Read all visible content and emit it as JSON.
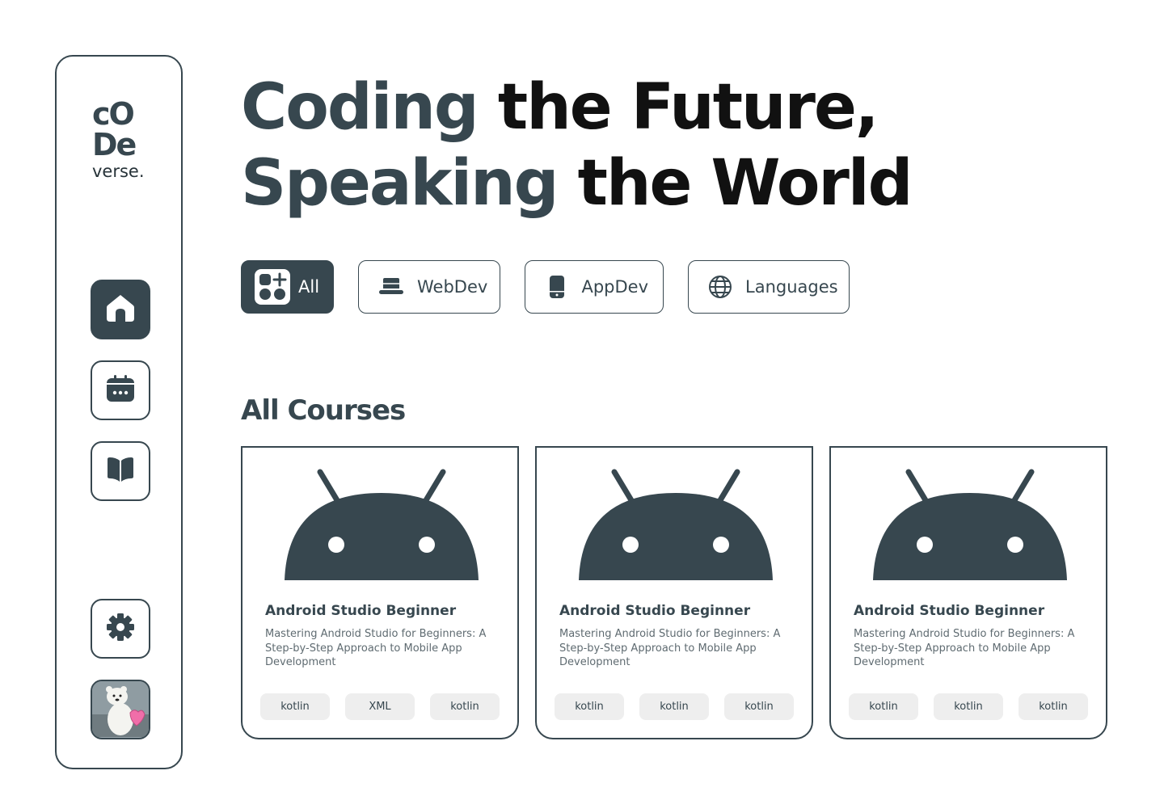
{
  "brand": {
    "logo_line1": "cO",
    "logo_line2": "De",
    "logo_line3": "verse."
  },
  "sidebar": {
    "items": [
      {
        "icon": "home-icon",
        "active": true
      },
      {
        "icon": "calendar-icon",
        "active": false
      },
      {
        "icon": "book-icon",
        "active": false
      },
      {
        "icon": "gear-icon",
        "active": false
      },
      {
        "icon": "avatar",
        "active": false
      }
    ]
  },
  "hero": {
    "line1_bold": "Coding",
    "line1_rest": " the Future,",
    "line2_bold": "Speaking",
    "line2_rest": " the World"
  },
  "filters": [
    {
      "label": "All",
      "icon": "apps-add-icon",
      "active": true
    },
    {
      "label": "WebDev",
      "icon": "laptop-icon",
      "active": false
    },
    {
      "label": "AppDev",
      "icon": "phone-icon",
      "active": false
    },
    {
      "label": "Languages",
      "icon": "globe-icon",
      "active": false
    }
  ],
  "section_title": "All Courses",
  "courses": [
    {
      "title": "Android Studio Beginner",
      "description": "Mastering Android Studio for Beginners: A Step-by-Step Approach to Mobile App Development",
      "tags": [
        "kotlin",
        "XML",
        "kotlin"
      ]
    },
    {
      "title": "Android Studio Beginner",
      "description": "Mastering Android Studio for Beginners: A Step-by-Step Approach to Mobile App Development",
      "tags": [
        "kotlin",
        "kotlin",
        "kotlin"
      ]
    },
    {
      "title": "Android Studio Beginner",
      "description": "Mastering Android Studio for Beginners: A Step-by-Step Approach to Mobile App Development",
      "tags": [
        "kotlin",
        "kotlin",
        "kotlin"
      ]
    }
  ],
  "colors": {
    "primary": "#37474f",
    "tag_bg": "#eeeeee",
    "desc_text": "#5f6b71"
  }
}
